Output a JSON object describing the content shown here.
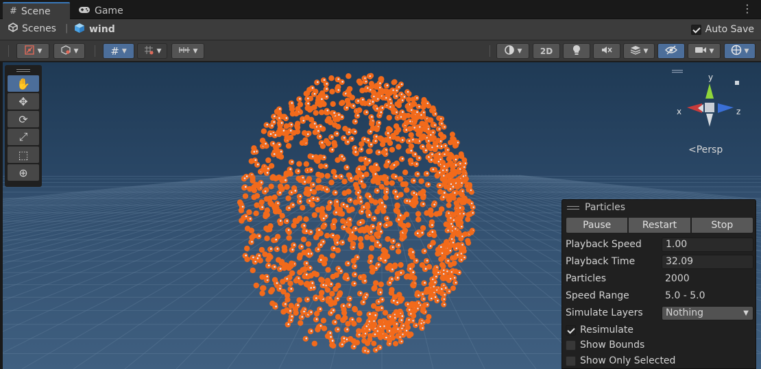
{
  "tabs": [
    {
      "label": "Scene",
      "icon": "grid-icon",
      "active": true
    },
    {
      "label": "Game",
      "icon": "gamepad-icon",
      "active": false
    }
  ],
  "breadcrumb": {
    "root": "Scenes",
    "current": "wind"
  },
  "autosave": {
    "label": "Auto Save",
    "checked": true
  },
  "toolbar": {
    "view_2d_label": "2D"
  },
  "gizmo": {
    "axis_y": "y",
    "axis_x": "x",
    "axis_z": "z",
    "projection_label": "Persp"
  },
  "particles_panel": {
    "title": "Particles",
    "buttons": {
      "pause": "Pause",
      "restart": "Restart",
      "stop": "Stop"
    },
    "rows": {
      "playback_speed": {
        "label": "Playback Speed",
        "value": "1.00"
      },
      "playback_time": {
        "label": "Playback Time",
        "value": "32.09"
      },
      "particles": {
        "label": "Particles",
        "value": "2000"
      },
      "speed_range": {
        "label": "Speed Range",
        "value": "5.0 - 5.0"
      },
      "simulate_layers": {
        "label": "Simulate Layers",
        "value": "Nothing"
      }
    },
    "checkboxes": {
      "resimulate": {
        "label": "Resimulate",
        "checked": true
      },
      "show_bounds": {
        "label": "Show Bounds",
        "checked": false
      },
      "show_only_selected": {
        "label": "Show Only Selected",
        "checked": false
      }
    }
  },
  "colors": {
    "accent": "#4c6e9a",
    "particle": "#f26a1b",
    "sky": "#213a54"
  }
}
